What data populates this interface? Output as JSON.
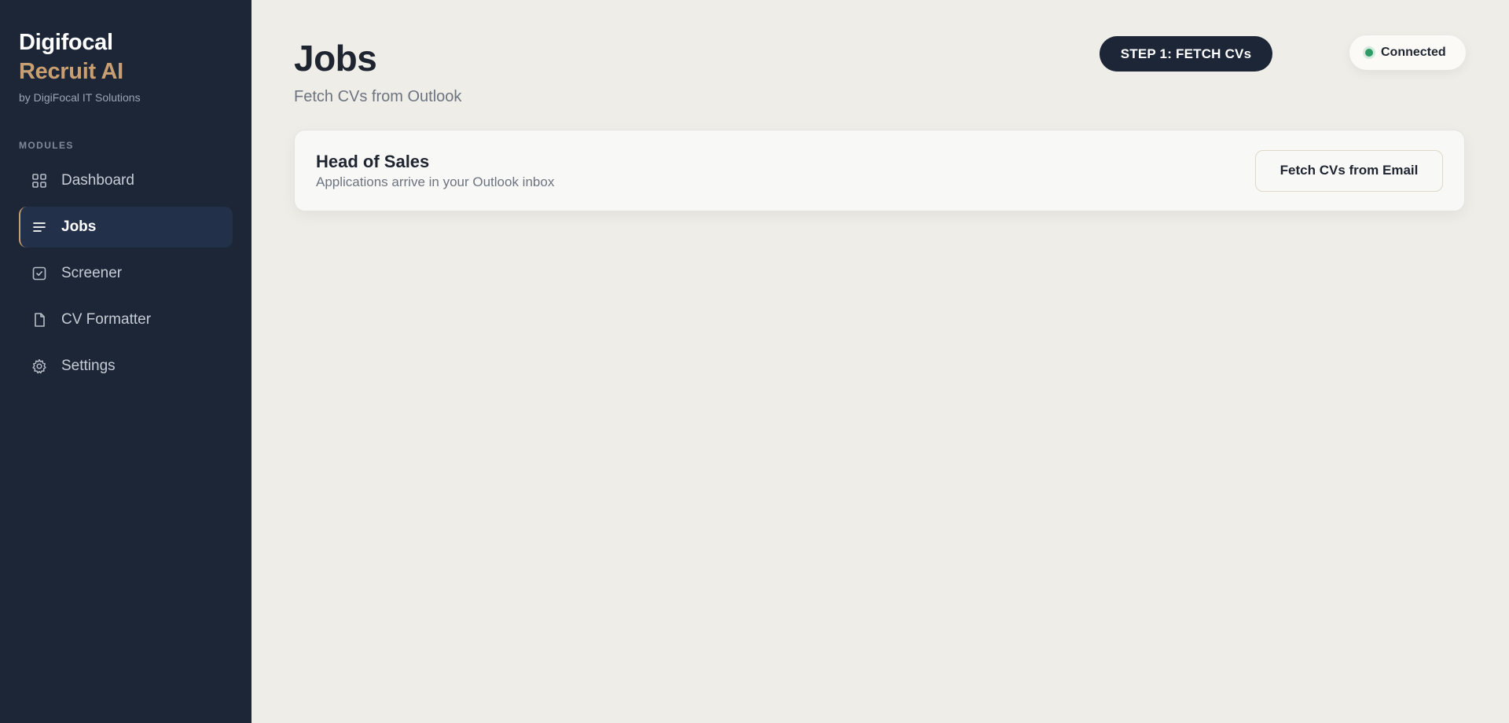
{
  "brand": {
    "line1": "Digifocal",
    "line2": "Recruit AI",
    "byline": "by DigiFocal IT Solutions"
  },
  "sidebar": {
    "section_label": "MODULES",
    "items": [
      {
        "label": "Dashboard",
        "icon": "grid-icon"
      },
      {
        "label": "Jobs",
        "icon": "list-icon",
        "active": true
      },
      {
        "label": "Screener",
        "icon": "check-square-icon"
      },
      {
        "label": "CV Formatter",
        "icon": "file-icon"
      },
      {
        "label": "Settings",
        "icon": "gear-icon"
      }
    ]
  },
  "header": {
    "title": "Jobs",
    "subtitle": "Fetch CVs from Outlook",
    "step_label": "STEP 1: FETCH CVs",
    "status_label": "Connected"
  },
  "job": {
    "title": "Head of Sales",
    "description": "Applications arrive in your Outlook inbox",
    "action_label": "Fetch CVs from Email"
  },
  "colors": {
    "sidebar_bg": "#1c2636",
    "accent": "#c99f72",
    "page_bg": "#eeede8",
    "status_green": "#2d9b66"
  }
}
